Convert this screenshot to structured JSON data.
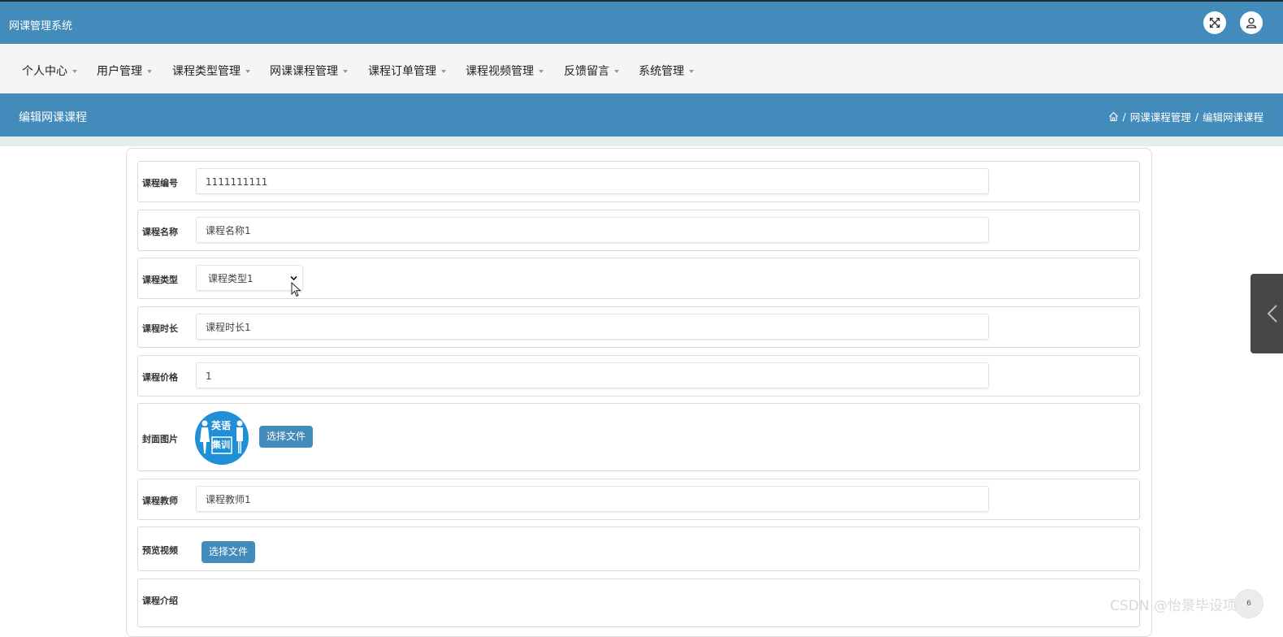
{
  "app": {
    "title": "网课管理系统"
  },
  "topbar_icons": [
    "fullscreen-icon",
    "user-icon"
  ],
  "nav": {
    "items": [
      {
        "label": "个人中心"
      },
      {
        "label": "用户管理"
      },
      {
        "label": "课程类型管理"
      },
      {
        "label": "网课课程管理"
      },
      {
        "label": "课程订单管理"
      },
      {
        "label": "课程视频管理"
      },
      {
        "label": "反馈留言"
      },
      {
        "label": "系统管理"
      }
    ]
  },
  "header": {
    "page_title": "编辑网课课程",
    "breadcrumb": {
      "sep": "/",
      "items": [
        "网课课程管理",
        "编辑网课课程"
      ]
    }
  },
  "form": {
    "course_no": {
      "label": "课程编号",
      "value": "1111111111"
    },
    "course_name": {
      "label": "课程名称",
      "value": "课程名称1"
    },
    "course_type": {
      "label": "课程类型",
      "selected": "课程类型1"
    },
    "course_duration": {
      "label": "课程时长",
      "value": "课程时长1"
    },
    "course_price": {
      "label": "课程价格",
      "value": "1"
    },
    "cover_image": {
      "label": "封面图片",
      "button": "选择文件",
      "image_text_top": "英语",
      "image_text_bottom": "集训"
    },
    "course_teacher": {
      "label": "课程教师",
      "value": "课程教师1"
    },
    "preview_video": {
      "label": "预览视频",
      "button": "选择文件"
    },
    "course_intro": {
      "label": "课程介绍"
    }
  },
  "watermark": "CSDN @怡景毕设项目",
  "corner_badge": "6"
}
